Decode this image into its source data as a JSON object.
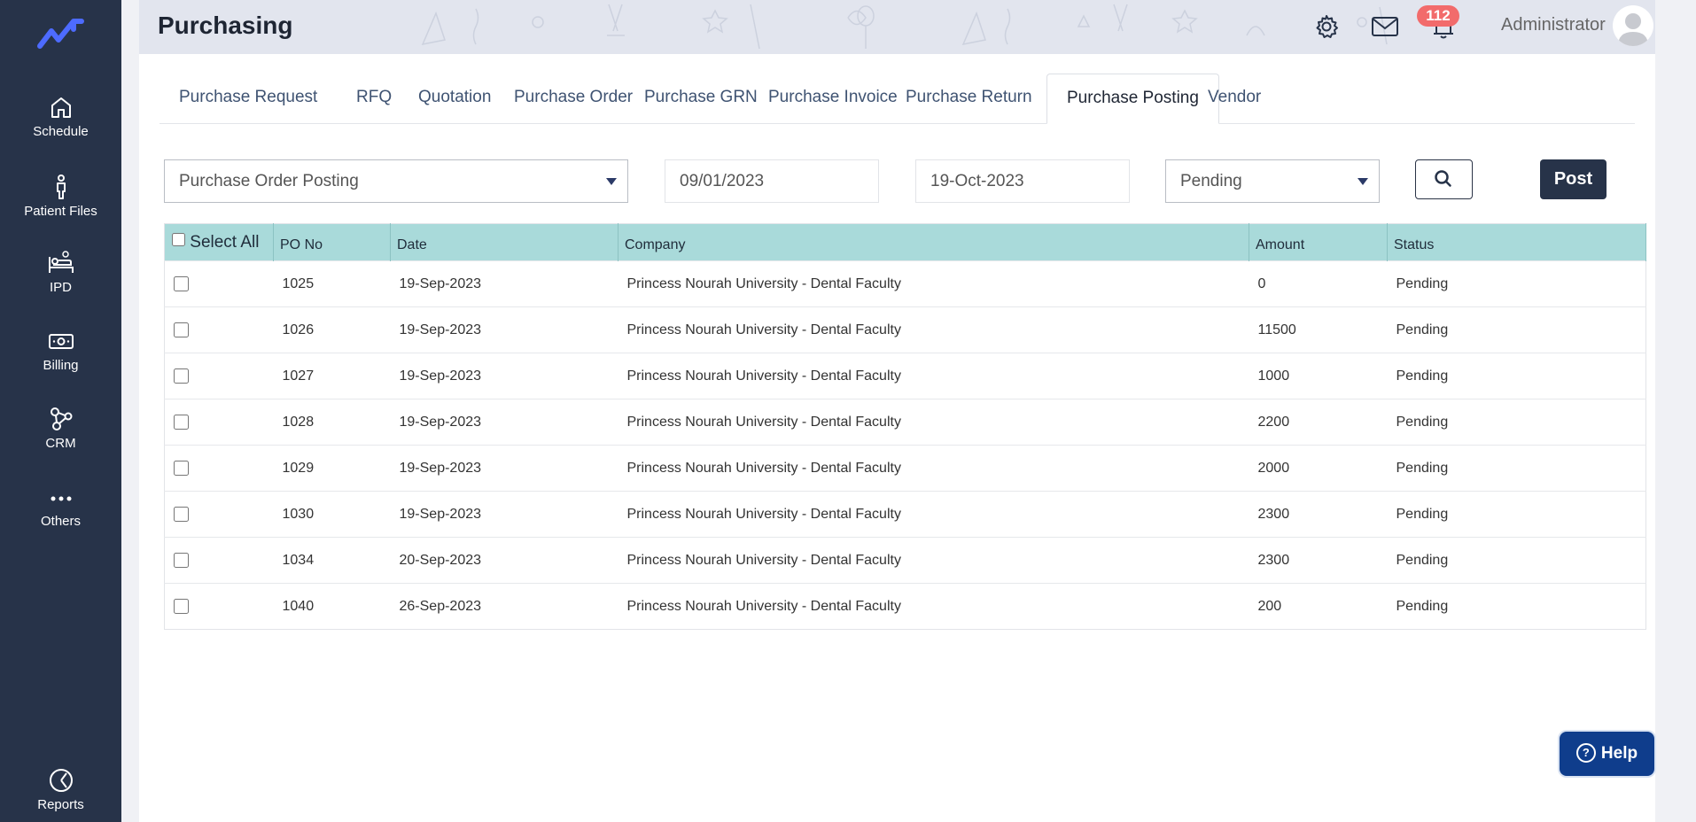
{
  "sidebar": {
    "items": [
      {
        "label": "Schedule",
        "icon": "home-icon"
      },
      {
        "label": "Patient Files",
        "icon": "person-icon"
      },
      {
        "label": "IPD",
        "icon": "bed-icon"
      },
      {
        "label": "Billing",
        "icon": "money-icon"
      },
      {
        "label": "CRM",
        "icon": "network-icon"
      },
      {
        "label": "Others",
        "icon": "more-icon"
      }
    ],
    "reports_label": "Reports"
  },
  "header": {
    "title": "Purchasing",
    "notification_count": "112",
    "user_name": "Administrator"
  },
  "tabs": [
    {
      "label": "Purchase Request"
    },
    {
      "label": "RFQ"
    },
    {
      "label": "Quotation"
    },
    {
      "label": "Purchase Order"
    },
    {
      "label": "Purchase GRN"
    },
    {
      "label": "Purchase Invoice"
    },
    {
      "label": "Purchase Return"
    },
    {
      "label": "Purchase Posting",
      "active": true
    },
    {
      "label": "Vendor"
    }
  ],
  "filters": {
    "posting_type": "Purchase Order Posting",
    "date_from": "09/01/2023",
    "date_to": "19-Oct-2023",
    "status": "Pending",
    "post_label": "Post"
  },
  "table": {
    "headers": {
      "select_all": "Select All",
      "po_no": "PO No",
      "date": "Date",
      "company": "Company",
      "amount": "Amount",
      "status": "Status"
    },
    "rows": [
      {
        "po_no": "1025",
        "date": "19-Sep-2023",
        "company": "Princess Nourah University - Dental Faculty",
        "amount": "0",
        "status": "Pending"
      },
      {
        "po_no": "1026",
        "date": "19-Sep-2023",
        "company": "Princess Nourah University - Dental Faculty",
        "amount": "11500",
        "status": "Pending"
      },
      {
        "po_no": "1027",
        "date": "19-Sep-2023",
        "company": "Princess Nourah University - Dental Faculty",
        "amount": "1000",
        "status": "Pending"
      },
      {
        "po_no": "1028",
        "date": "19-Sep-2023",
        "company": "Princess Nourah University - Dental Faculty",
        "amount": "2200",
        "status": "Pending"
      },
      {
        "po_no": "1029",
        "date": "19-Sep-2023",
        "company": "Princess Nourah University - Dental Faculty",
        "amount": "2000",
        "status": "Pending"
      },
      {
        "po_no": "1030",
        "date": "19-Sep-2023",
        "company": "Princess Nourah University - Dental Faculty",
        "amount": "2300",
        "status": "Pending"
      },
      {
        "po_no": "1034",
        "date": "20-Sep-2023",
        "company": "Princess Nourah University - Dental Faculty",
        "amount": "2300",
        "status": "Pending"
      },
      {
        "po_no": "1040",
        "date": "26-Sep-2023",
        "company": "Princess Nourah University - Dental Faculty",
        "amount": "200",
        "status": "Pending"
      }
    ]
  },
  "help": {
    "label": "Help"
  },
  "colors": {
    "sidebar_bg": "#273349",
    "header_bg": "#e2e5ee",
    "table_header_bg": "#a9dada",
    "badge": "#f26b6b",
    "help_button": "#0f3d8c"
  }
}
